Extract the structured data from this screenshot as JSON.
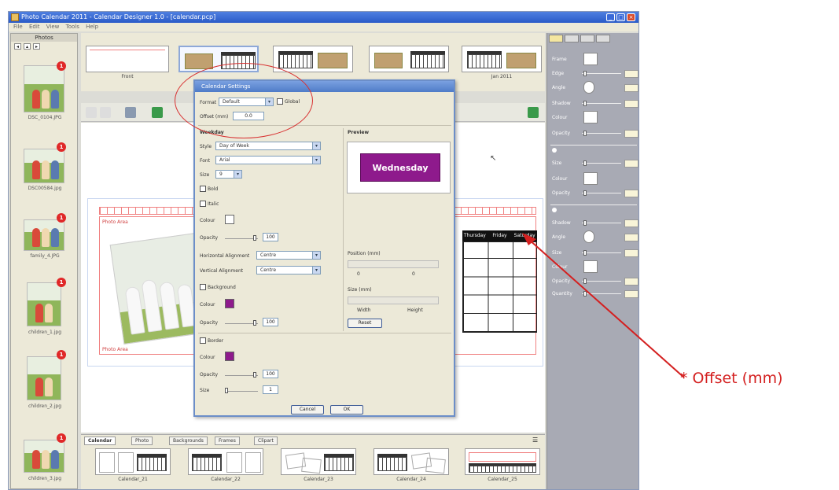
{
  "window": {
    "title": "Photo Calendar 2011 - Calendar Designer 1.0 - [calendar.pcp]",
    "menus": [
      "File",
      "Edit",
      "View",
      "Tools",
      "Help"
    ]
  },
  "photos": {
    "header": "Photos",
    "items": [
      {
        "name": "DSC_0104.JPG",
        "count": "1"
      },
      {
        "name": "DSC00584.jpg",
        "count": "1"
      },
      {
        "name": "family_4.JPG",
        "count": "1"
      },
      {
        "name": "children_1.jpg",
        "count": "1"
      },
      {
        "name": "children_2.jpg",
        "count": "1"
      },
      {
        "name": "children_3.jpg",
        "count": "1"
      }
    ]
  },
  "pages": [
    {
      "label": "Front"
    },
    {
      "label": ""
    },
    {
      "label": ""
    },
    {
      "label": ""
    },
    {
      "label": "Jan 2011"
    }
  ],
  "canvas": {
    "photo_label_top": "Photo Area",
    "photo_label_bottom": "Photo Area",
    "weekdays": [
      "Thursday",
      "Friday",
      "Saturday"
    ]
  },
  "dialog": {
    "title": "Calendar Settings",
    "format_label": "Format",
    "format_value": "Default",
    "global_label": "Global",
    "offset_label": "Offset (mm)",
    "offset_value": "0.0",
    "weekday_section": "Weekday",
    "style_label": "Style",
    "style_value": "Day of Week",
    "font_label": "Font",
    "font_value": "Arial",
    "size_label": "Size",
    "size_value": "9",
    "bold_label": "Bold",
    "italic_label": "Italic",
    "colour_label": "Colour",
    "opacity_label": "Opacity",
    "opacity_value": "100",
    "halign_label": "Horizontal Alignment",
    "halign_value": "Centre",
    "valign_label": "Vertical Alignment",
    "valign_value": "Centre",
    "background_label": "Background",
    "bg_colour_label": "Colour",
    "bg_opacity_label": "Opacity",
    "bg_opacity_value": "100",
    "border_label": "Border",
    "border_colour_label": "Colour",
    "border_opacity_label": "Opacity",
    "border_opacity_value": "100",
    "border_size_label": "Size",
    "border_size_value": "1",
    "preview_label": "Preview",
    "preview_text": "Wednesday",
    "position_label": "Position (mm)",
    "size_mm_label": "Size (mm)",
    "pos_x": "0",
    "pos_y": "0",
    "width_label": "Width",
    "height_label": "Height",
    "reset_button": "Reset",
    "cancel_button": "Cancel",
    "ok_button": "OK"
  },
  "bottom_tabs": [
    "Calendar",
    "Photo",
    "Backgrounds",
    "Frames",
    "Clipart"
  ],
  "layouts": [
    {
      "label": "Calendar_21"
    },
    {
      "label": "Calendar_22"
    },
    {
      "label": "Calendar_23"
    },
    {
      "label": "Calendar_24"
    },
    {
      "label": "Calendar_25"
    }
  ],
  "properties": {
    "rows": [
      "Frame",
      "Edge",
      "Angle",
      "Shadow",
      "Colour",
      "Opacity",
      "Size",
      "Colour",
      "Opacity",
      "Shadow",
      "Angle",
      "Size",
      "Colour",
      "Opacity",
      "Quantity"
    ]
  },
  "annotation": "* Offset (mm)",
  "colors": {
    "accent": "#8e1a8c",
    "annotation": "#d42020",
    "titlebar": "#2a5bc8"
  }
}
